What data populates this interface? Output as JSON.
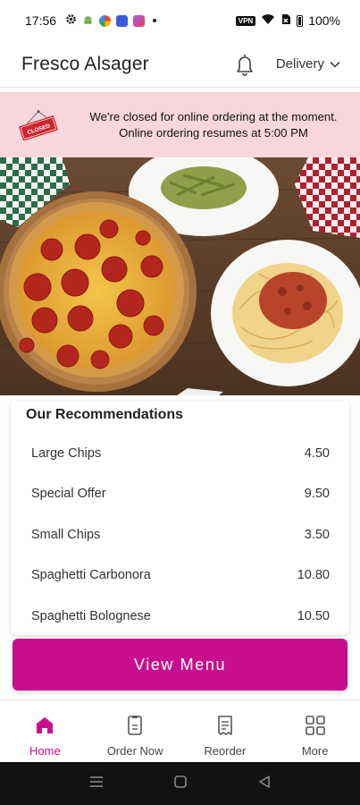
{
  "status_bar": {
    "time": "17:56",
    "battery": "100%",
    "vpn": "VPN",
    "icons": [
      "settings-gear-icon",
      "android-icon",
      "browser-icon",
      "messenger-icon",
      "camera-icon",
      "wifi-icon",
      "sim-icon",
      "battery-icon"
    ]
  },
  "header": {
    "title": "Fresco Alsager",
    "delivery_label": "Delivery"
  },
  "banner": {
    "sign_text": "CLOSED",
    "line1": "We're closed for online ordering at the moment.",
    "line2": "Online ordering resumes at 5:00 PM"
  },
  "recommendations": {
    "title": "Our Recommendations",
    "items": [
      {
        "name": "Large Chips",
        "price": "4.50"
      },
      {
        "name": "Special Offer",
        "price": "9.50"
      },
      {
        "name": "Small Chips",
        "price": "3.50"
      },
      {
        "name": "Spaghetti Carbonora",
        "price": "10.80"
      },
      {
        "name": "Spaghetti Bolognese",
        "price": "10.50"
      }
    ]
  },
  "view_menu_label": "View Menu",
  "bottom_nav": {
    "items": [
      {
        "label": "Home",
        "icon": "home-icon",
        "active": true
      },
      {
        "label": "Order Now",
        "icon": "order-icon",
        "active": false
      },
      {
        "label": "Reorder",
        "icon": "receipt-icon",
        "active": false
      },
      {
        "label": "More",
        "icon": "grid-icon",
        "active": false
      }
    ]
  },
  "colors": {
    "accent": "#c8108f",
    "banner_bg": "#f7d7dc",
    "sign_red": "#d0242f"
  }
}
